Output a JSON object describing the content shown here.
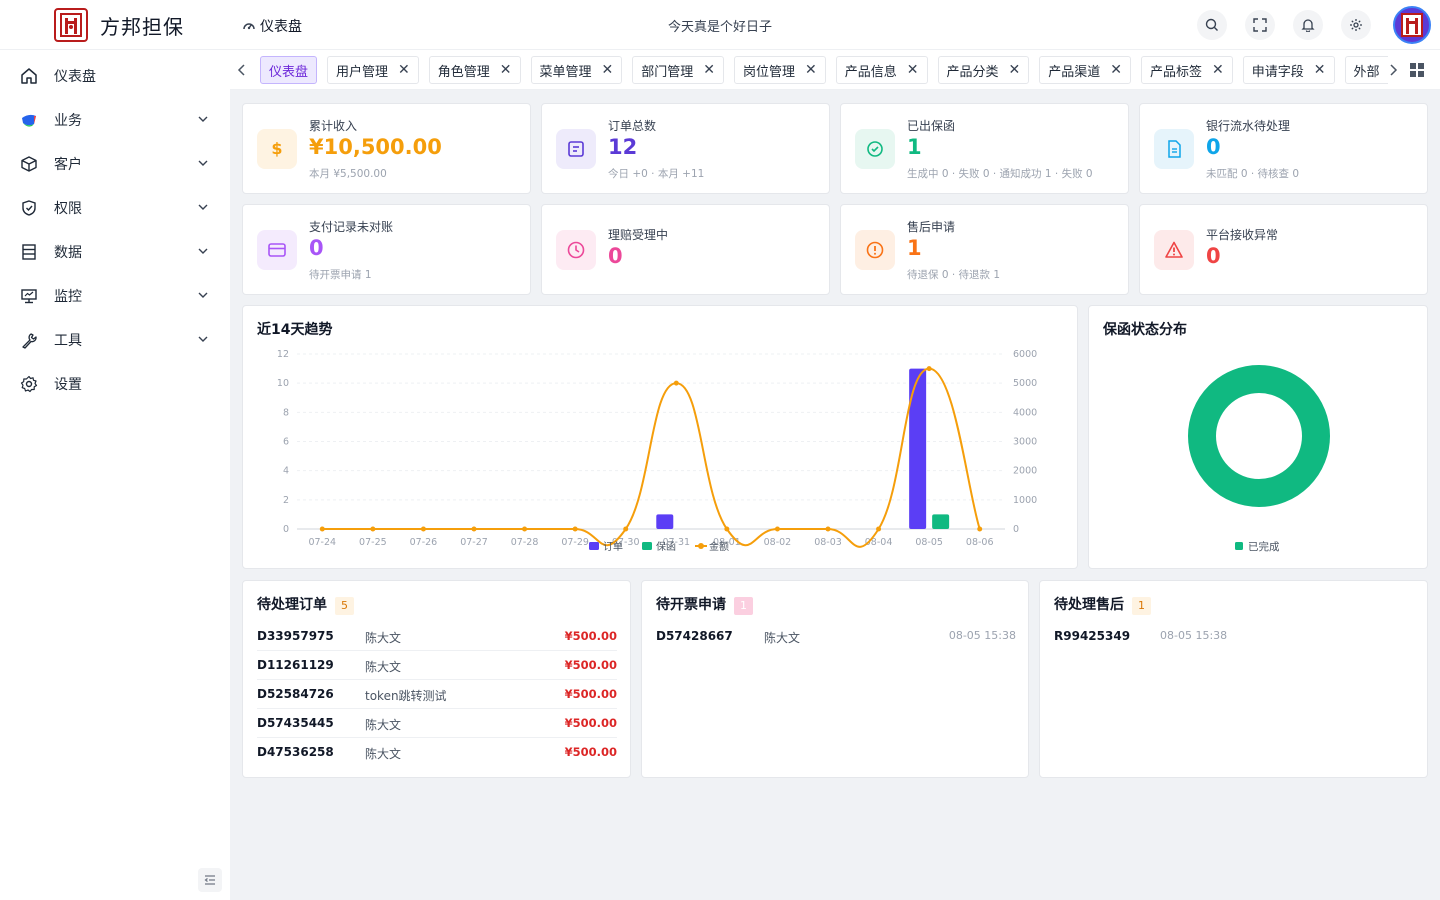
{
  "brand": {
    "name": "方邦担保"
  },
  "header": {
    "breadcrumb": "仪表盘",
    "greeting": "今天真是个好日子",
    "buttons": [
      "search-icon",
      "fullscreen-icon",
      "bell-icon",
      "gear-icon"
    ]
  },
  "sidebar": {
    "items": [
      {
        "label": "仪表盘",
        "icon": "home-icon",
        "expandable": false
      },
      {
        "label": "业务",
        "icon": "business-icon",
        "expandable": true
      },
      {
        "label": "客户",
        "icon": "cube-icon",
        "expandable": true
      },
      {
        "label": "权限",
        "icon": "shield-icon",
        "expandable": true
      },
      {
        "label": "数据",
        "icon": "database-icon",
        "expandable": true
      },
      {
        "label": "监控",
        "icon": "monitor-icon",
        "expandable": true
      },
      {
        "label": "工具",
        "icon": "wrench-icon",
        "expandable": true
      },
      {
        "label": "设置",
        "icon": "gear-icon",
        "expandable": false
      }
    ]
  },
  "tabs": [
    {
      "label": "仪表盘",
      "active": true,
      "closable": false
    },
    {
      "label": "用户管理",
      "closable": true
    },
    {
      "label": "角色管理",
      "closable": true
    },
    {
      "label": "菜单管理",
      "closable": true
    },
    {
      "label": "部门管理",
      "closable": true
    },
    {
      "label": "岗位管理",
      "closable": true
    },
    {
      "label": "产品信息",
      "closable": true
    },
    {
      "label": "产品分类",
      "closable": true
    },
    {
      "label": "产品渠道",
      "closable": true
    },
    {
      "label": "产品标签",
      "closable": true
    },
    {
      "label": "申请字段",
      "closable": true
    },
    {
      "label": "外部",
      "closable": true
    }
  ],
  "stats": [
    {
      "label": "累计收入",
      "value": "¥10,500.00",
      "sub": "本月 ¥5,500.00",
      "icon": "dollar-icon",
      "color": "#f59e0b",
      "bg": "#fef3e2"
    },
    {
      "label": "订单总数",
      "value": "12",
      "sub": "今日 +0 · 本月 +11",
      "icon": "order-icon",
      "color": "#5b3ad6",
      "bg": "#eeebfb"
    },
    {
      "label": "已出保函",
      "value": "1",
      "sub": "生成中 0 · 失败 0 · 通知成功 1 · 失败 0",
      "icon": "check-circle-icon",
      "color": "#10b981",
      "bg": "#e7f7f1"
    },
    {
      "label": "银行流水待处理",
      "value": "0",
      "sub": "未匹配 0 · 待核查 0",
      "icon": "document-icon",
      "color": "#0ea5e9",
      "bg": "#e6f4fb"
    },
    {
      "label": "支付记录未对账",
      "value": "0",
      "sub": "待开票申请 1",
      "icon": "card-icon",
      "color": "#a855f7",
      "bg": "#f4ebfd"
    },
    {
      "label": "理赔受理中",
      "value": "0",
      "sub": "",
      "icon": "clock-icon",
      "color": "#ec4899",
      "bg": "#fdebf3"
    },
    {
      "label": "售后申请",
      "value": "1",
      "sub": "待退保 0 · 待退款 1",
      "icon": "alert-circle-icon",
      "color": "#f97316",
      "bg": "#feefe3"
    },
    {
      "label": "平台接收异常",
      "value": "0",
      "sub": "",
      "icon": "warning-icon",
      "color": "#ef4444",
      "bg": "#fdeaea"
    }
  ],
  "trend": {
    "title": "近14天趋势",
    "chart_data": {
      "type": "bar",
      "categories": [
        "07-24",
        "07-25",
        "07-26",
        "07-27",
        "07-28",
        "07-29",
        "07-30",
        "07-31",
        "08-01",
        "08-02",
        "08-03",
        "08-04",
        "08-05",
        "08-06"
      ],
      "series": [
        {
          "name": "订单",
          "type": "bar",
          "axis": "left",
          "color": "#5b3ef5",
          "values": [
            0,
            0,
            0,
            0,
            0,
            0,
            0,
            1,
            0,
            0,
            0,
            0,
            11,
            0
          ]
        },
        {
          "name": "保函",
          "type": "bar",
          "axis": "left",
          "color": "#10b981",
          "values": [
            0,
            0,
            0,
            0,
            0,
            0,
            0,
            0,
            0,
            0,
            0,
            0,
            1,
            0
          ]
        },
        {
          "name": "金额",
          "type": "line",
          "axis": "right",
          "color": "#f59e0b",
          "smooth": true,
          "values": [
            0,
            0,
            0,
            0,
            0,
            0,
            0,
            5000,
            0,
            0,
            0,
            0,
            5500,
            0
          ]
        }
      ],
      "y_left": {
        "min": 0,
        "max": 12,
        "ticks": [
          0,
          2,
          4,
          6,
          8,
          10,
          12
        ]
      },
      "y_right": {
        "min": 0,
        "max": 6000,
        "ticks": [
          0,
          1000,
          2000,
          3000,
          4000,
          5000,
          6000
        ]
      },
      "grid": true,
      "legend": "bottom"
    }
  },
  "distribution": {
    "title": "保函状态分布",
    "chart_data": {
      "type": "pie",
      "donut": true,
      "slices": [
        {
          "name": "已完成",
          "value": 1,
          "color": "#10b981"
        }
      ],
      "legend": "bottom"
    }
  },
  "pending_orders": {
    "title": "待处理订单",
    "count": "5",
    "rows": [
      {
        "id": "D33957975",
        "name": "陈大文",
        "amount": "¥500.00"
      },
      {
        "id": "D11261129",
        "name": "陈大文",
        "amount": "¥500.00"
      },
      {
        "id": "D52584726",
        "name": "token跳转测试",
        "amount": "¥500.00"
      },
      {
        "id": "D57435445",
        "name": "陈大文",
        "amount": "¥500.00"
      },
      {
        "id": "D47536258",
        "name": "陈大文",
        "amount": "¥500.00"
      }
    ]
  },
  "pending_invoices": {
    "title": "待开票申请",
    "count": "1",
    "rows": [
      {
        "id": "D57428667",
        "name": "陈大文",
        "time": "08-05 15:38"
      }
    ]
  },
  "pending_aftersales": {
    "title": "待处理售后",
    "count": "1",
    "rows": [
      {
        "id": "R99425349",
        "time": "08-05 15:38"
      }
    ]
  }
}
